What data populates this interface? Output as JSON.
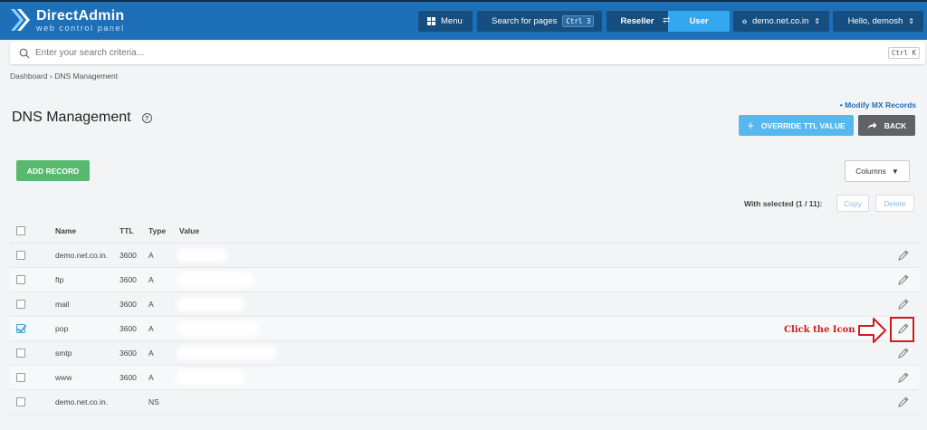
{
  "header": {
    "brand_title": "DirectAdmin",
    "brand_subtitle": "web control panel",
    "menu_label": "Menu",
    "search_pages_label": "Search for pages",
    "search_pages_kbd": "Ctrl 3",
    "role_left": "Reseller",
    "role_right": "User",
    "domain": "demo.net.co.in",
    "greeting": "Hello, demosh"
  },
  "search": {
    "placeholder": "Enter your search criteria...",
    "kbd": "Ctrl K"
  },
  "breadcrumb": {
    "home": "Dashboard",
    "sep": "›",
    "current": "DNS Management"
  },
  "page": {
    "title": "DNS Management",
    "help": "?",
    "mx_link": "• Modify MX Records",
    "override_label": "OVERRIDE TTL VALUE",
    "back_label": "BACK",
    "add_label": "ADD RECORD",
    "columns_label": "Columns"
  },
  "selection": {
    "label": "With selected (1 / 11):",
    "copy": "Copy",
    "delete": "Delete"
  },
  "table": {
    "headers": {
      "name": "Name",
      "ttl": "TTL",
      "type": "Type",
      "value": "Value"
    },
    "rows": [
      {
        "name": "demo.net.co.in.",
        "ttl": "3600",
        "type": "A",
        "checked": false
      },
      {
        "name": "ftp",
        "ttl": "3600",
        "type": "A",
        "checked": false
      },
      {
        "name": "mail",
        "ttl": "3600",
        "type": "A",
        "checked": false
      },
      {
        "name": "pop",
        "ttl": "3600",
        "type": "A",
        "checked": true
      },
      {
        "name": "smtp",
        "ttl": "3600",
        "type": "A",
        "checked": false
      },
      {
        "name": "www",
        "ttl": "3600",
        "type": "A",
        "checked": false
      },
      {
        "name": "demo.net.co.in.",
        "ttl": "",
        "type": "NS",
        "checked": false
      }
    ]
  },
  "annotation": {
    "text": "Click the Icon",
    "color": "#d01c1c"
  },
  "colors": {
    "header": "#1d6fb8",
    "accent": "#34a8ee",
    "add": "#58b96e",
    "back": "#5f6266"
  }
}
